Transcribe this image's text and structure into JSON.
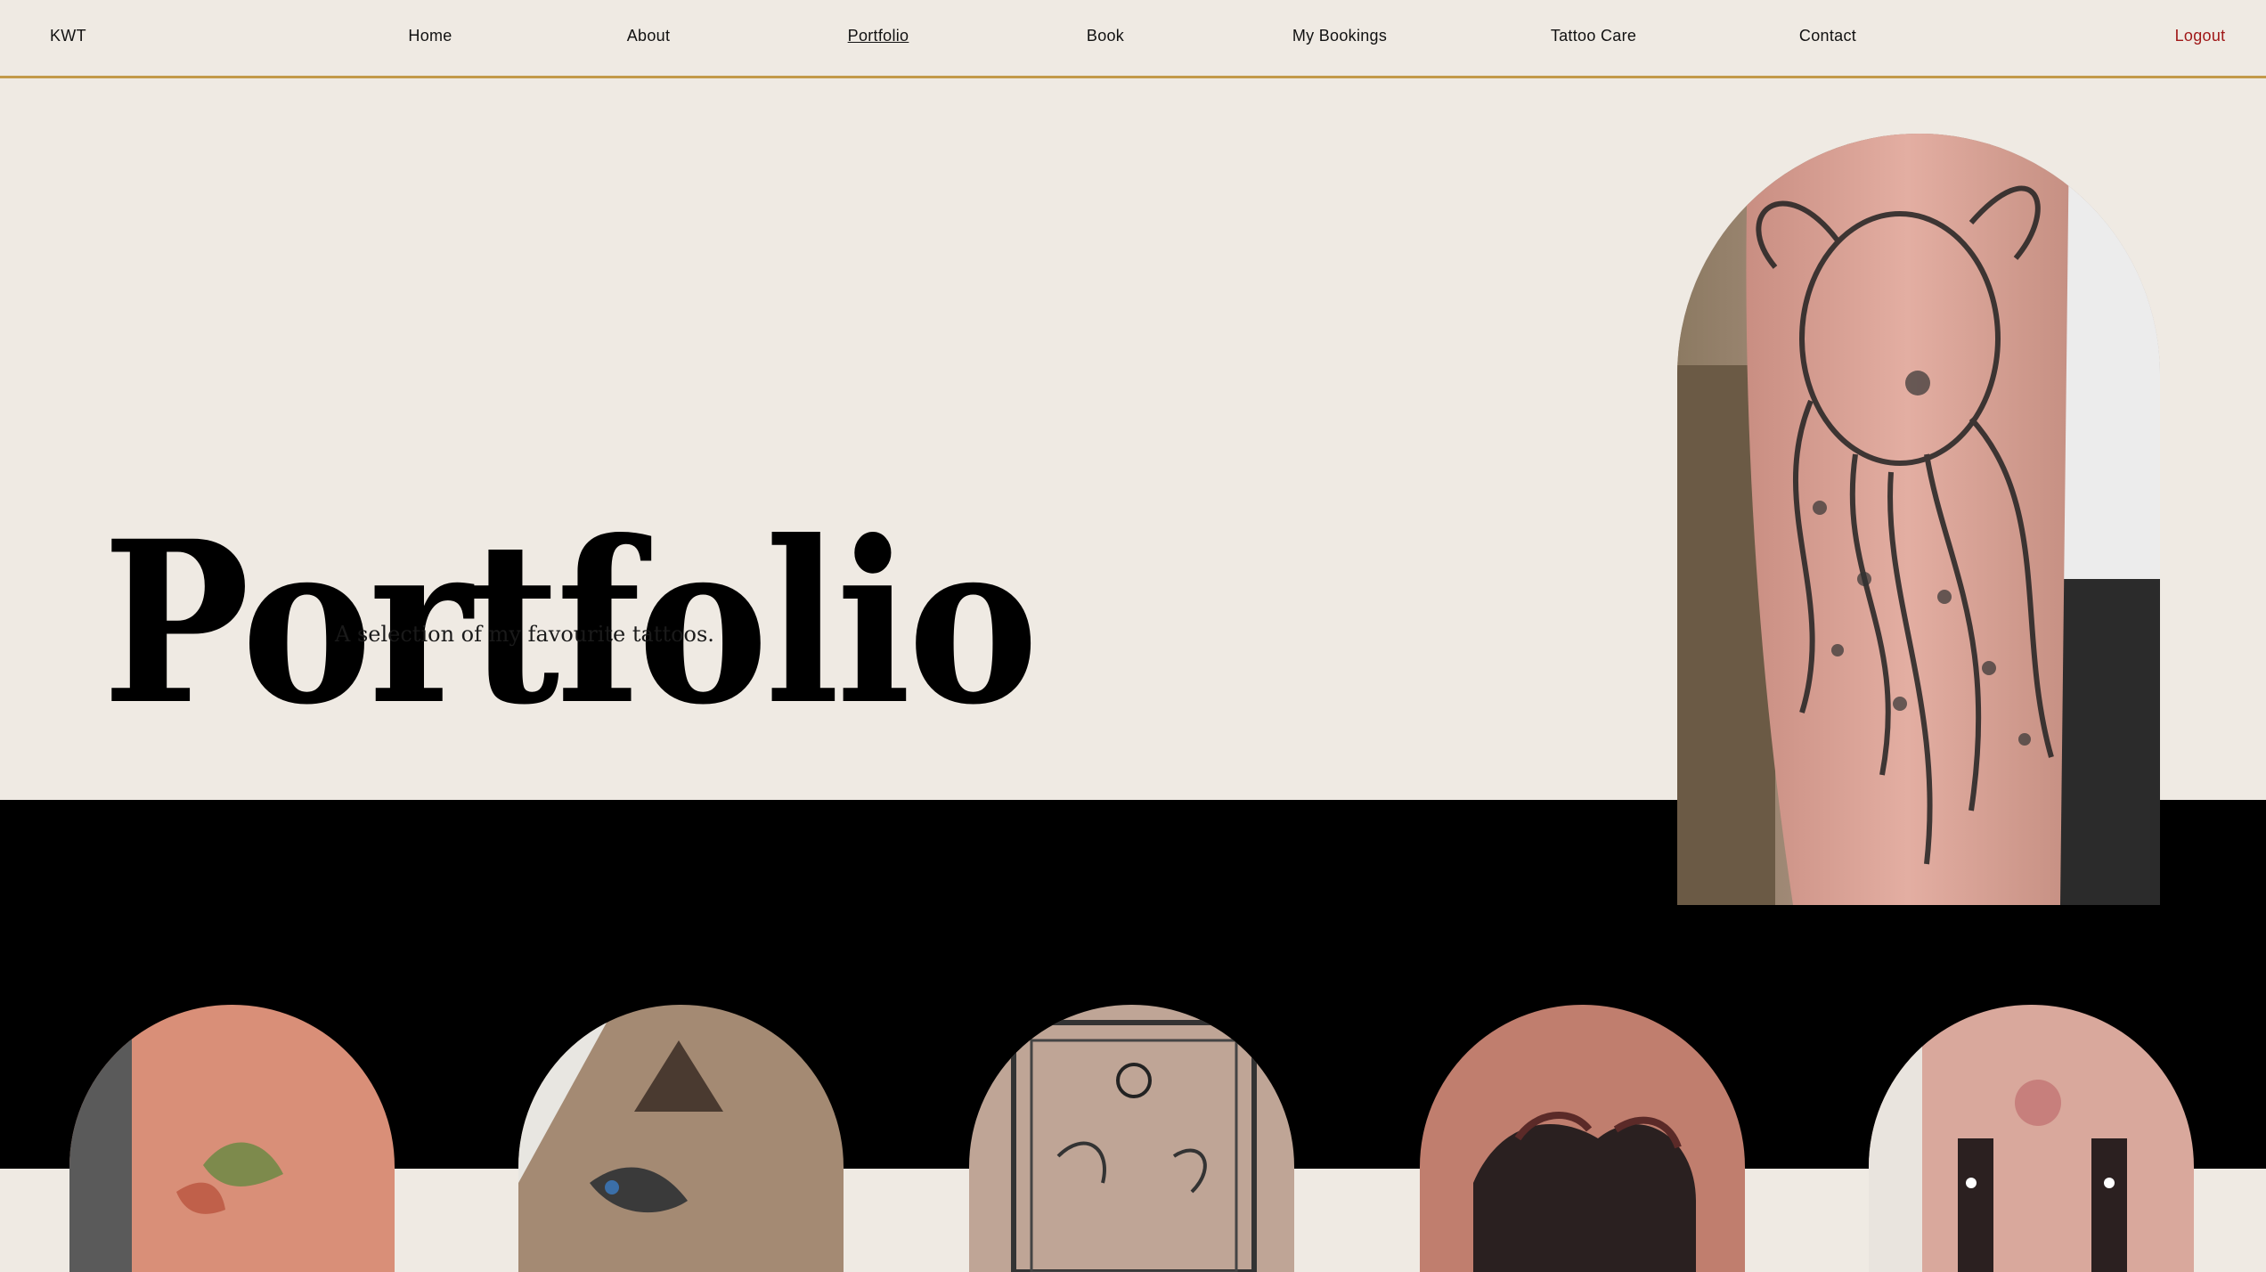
{
  "nav": {
    "brand": "KWT",
    "items": [
      {
        "label": "Home"
      },
      {
        "label": "About"
      },
      {
        "label": "Portfolio"
      },
      {
        "label": "Book"
      },
      {
        "label": "My Bookings"
      },
      {
        "label": "Tattoo Care"
      },
      {
        "label": "Contact"
      }
    ],
    "logout": "Logout"
  },
  "hero": {
    "title": "Portfolio",
    "subtitle": "A selection of my favourite tattoos."
  },
  "colors": {
    "background": "#efeae3",
    "nav_border": "#c39a4a",
    "logout": "#a01818",
    "dark_section": "#000000"
  },
  "images": {
    "feature": "octopus-tattoo-photo",
    "gallery": [
      "colour-flower-tattoo-photo",
      "dinosaur-mountain-tattoo-photo",
      "pisces-tarot-card-tattoo-photo",
      "black-red-wave-tattoo-photo",
      "flower-hands-tattoo-photo"
    ]
  }
}
